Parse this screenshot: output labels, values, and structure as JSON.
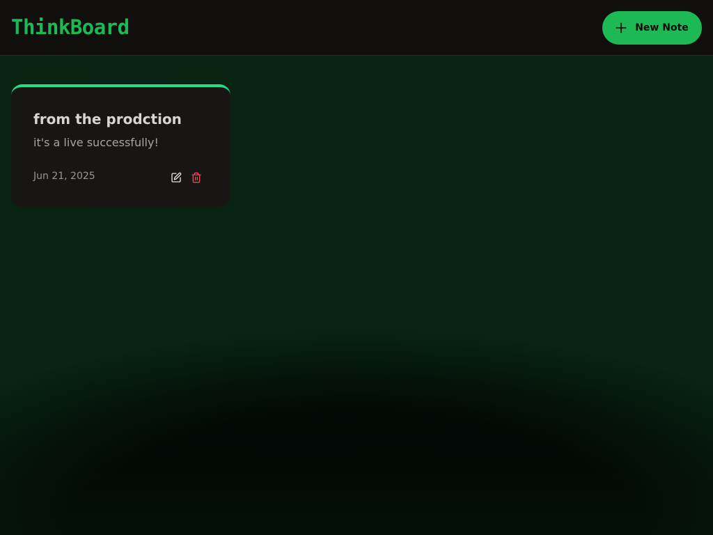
{
  "app": {
    "brand": "ThinkBoard",
    "new_note_label": "New Note",
    "accent_color": "#1db954"
  },
  "notes": [
    {
      "title": "from the prodction",
      "content": "it's a live successfully!",
      "date": "Jun 21, 2025",
      "accent_color": "#22e08a",
      "actions": [
        {
          "icon": "edit-icon",
          "color": "#e8e4e2"
        },
        {
          "icon": "trash-icon",
          "color": "#ef4a5a"
        }
      ]
    }
  ]
}
